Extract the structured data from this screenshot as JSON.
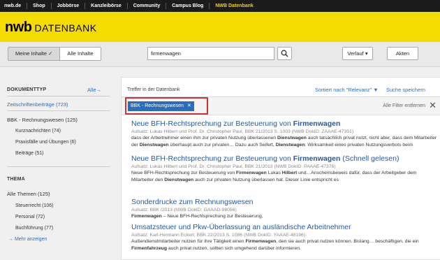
{
  "topnav": {
    "items": [
      {
        "label": "nwb.de"
      },
      {
        "label": "Shop"
      },
      {
        "label": "Jobbörse"
      },
      {
        "label": "Kanzleibörse"
      },
      {
        "label": "Community"
      },
      {
        "label": "Campus Blog"
      },
      {
        "label": "NWB Datenbank"
      }
    ]
  },
  "header": {
    "logo_nwb": "nwb",
    "logo_db": "DATENBANK"
  },
  "toolbar": {
    "my_content": "Meine Inhalte ✓",
    "all_content": "Alle Inhalte",
    "search_value": "firmenwagen",
    "history": "Verlauf",
    "files": "Akten"
  },
  "sidebar": {
    "doctype_heading": "DOKUMENTTYP",
    "all_link": "Alle",
    "journals": "Zeitschriftenbeiträge (723)",
    "bbk": "BBK - Rechnungswesen (125)",
    "bbk_sub": [
      "Kurznachrichten (74)",
      "Praxisfälle und Übungen (6)",
      "Beiträge (51)"
    ],
    "topic_heading": "THEMA",
    "all_topics": "Alle Themen (125)",
    "topic_sub": [
      "Steuerrecht (106)",
      "Personal (72)",
      "Buchführung (77)"
    ],
    "more": "Mehr anzeigen"
  },
  "results": {
    "heading": "Treffer in der Datenbank",
    "sort": "Sortiert nach \"Relevanz\"",
    "save_search": "Suche speichern",
    "filter_chip": "BBK - Rechnungswesen",
    "clear_filters": "Alle Filter entfernen",
    "items": [
      {
        "title_pre": "Neue BFH-Rechtsprechung zur Besteuerung von ",
        "title_hl": "Firmenwagen",
        "title_post": "",
        "meta": "Aufsatz: Lukas Hilbert und Prof. Dr. Christopher Paul, BBK 21/2013 S. 1003 (NWB DokID: ZAAAE-47351)",
        "snippet": [
          {
            "t": "dass der Arbeitnehmer einen ihm zur privaten Nutzung überlassenen "
          },
          {
            "t": "Dienstwagen",
            "b": true
          },
          {
            "t": " auch tatsächlich privat nutzt, nicht aber, dass dem Mitarbeiter der "
          },
          {
            "t": "Dienstwagen",
            "b": true
          },
          {
            "t": " überhaupt auch zur privaten… Dazu auch Seifert, "
          },
          {
            "t": "Dienstwagen",
            "b": true
          },
          {
            "t": ": Wirksamkeit eines privaten Nutzungsverbots beim"
          }
        ]
      },
      {
        "title_pre": "Neue BFH-Rechtsprechung zur Besteuerung von ",
        "title_hl": "Firmenwagen",
        "title_post": " (Schnell gelesen)",
        "meta": "Aufsatz: Lukas Hilbert und Prof. Dr. Christopher Paul, BBK 21/2013 (NWB DokID: PAAAE-47376)",
        "snippet": [
          {
            "t": "Neue BFH-Rechtsprechung zur Besteuerung von "
          },
          {
            "t": "Firmenwagen",
            "b": true
          },
          {
            "t": " Lukas "
          },
          {
            "t": "Hilbert",
            "b": true
          },
          {
            "t": " und…Anscheinsbeweis dafür, dass der Arbeitgeber dem Mitarbeiter den "
          },
          {
            "t": "Dienstwagen",
            "b": true
          },
          {
            "t": " auch zur privaten Nutzung überlassen hat. Dieser Linie entspricht es"
          }
        ]
      },
      {
        "title_pre": "Sonderdrucke zum Rechnungswesen",
        "title_hl": "",
        "title_post": "",
        "meta": "Aufsatz: BBK /2013 (NWB DokID: GAAAD-98056)",
        "snippet": [
          {
            "t": "Firmenwagen",
            "b": true
          },
          {
            "t": " – Neue BFH-Rechtsprechung zur Besteuerung,"
          }
        ]
      },
      {
        "title_pre": "Umsatzsteuer und Pkw-Überlassung an ausländische Arbeitnehmer",
        "title_hl": "",
        "title_post": "",
        "meta": "Aufsatz: Karl-Hermann Eckert, BBK 22/2013 S. 1086 (NWB DokID: YAAAE-48196)",
        "snippet": [
          {
            "t": "Außendienstmitarbeiter nutzen für ihre Tätigkeit einen "
          },
          {
            "t": "Firmenwagen",
            "b": true
          },
          {
            "t": ", den sie auch privat nutzen können. Bislang… beschäftigen, die ein "
          },
          {
            "t": "Firmenfahrzeug",
            "b": true
          },
          {
            "t": " auch privat nutzen, sollten sich umgehend darüber informieren."
          }
        ]
      }
    ]
  }
}
